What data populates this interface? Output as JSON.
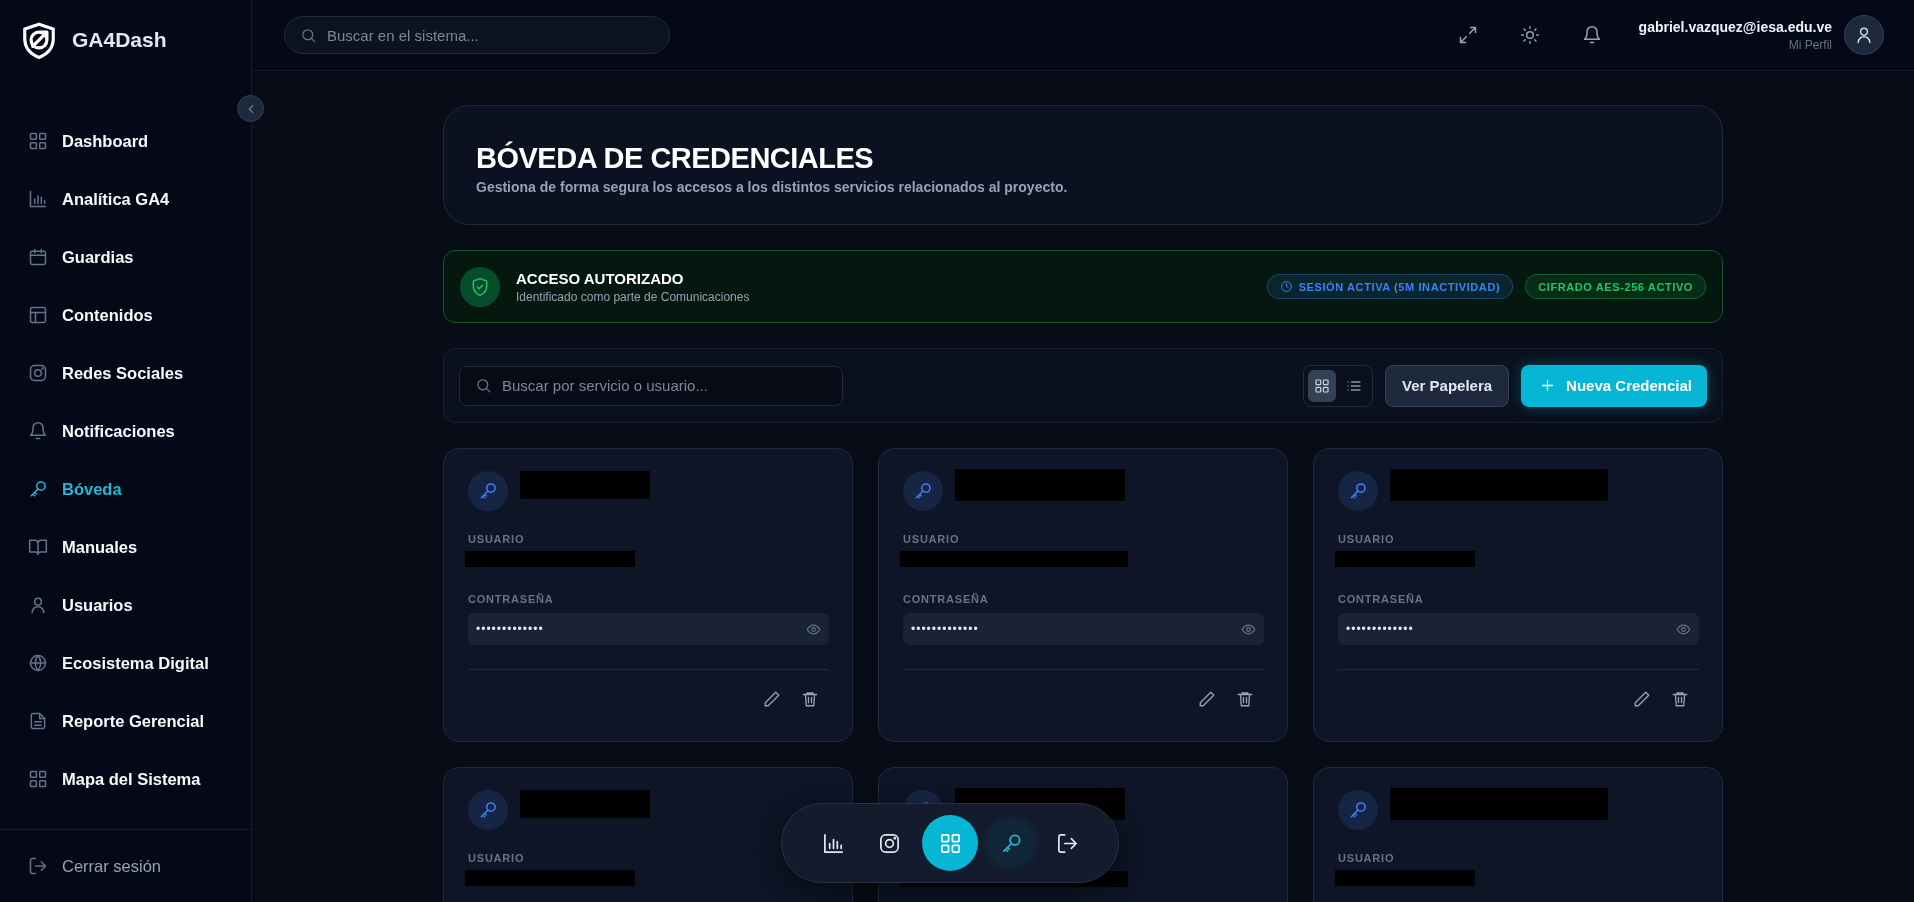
{
  "brand": {
    "name": "GA4Dash"
  },
  "header": {
    "search": {
      "placeholder": "Buscar en el sistema..."
    },
    "user": {
      "email": "gabriel.vazquez@iesa.edu.ve",
      "profile_link": "Mi Perfil"
    }
  },
  "sidebar": {
    "items": [
      {
        "label": "Dashboard",
        "kind": "grid",
        "selected": false
      },
      {
        "label": "Analítica GA4",
        "kind": "chart",
        "selected": false
      },
      {
        "label": "Guardias",
        "kind": "calendar",
        "selected": false
      },
      {
        "label": "Contenidos",
        "kind": "layout",
        "selected": false
      },
      {
        "label": "Redes Sociales",
        "kind": "instagram",
        "selected": false
      },
      {
        "label": "Notificaciones",
        "kind": "bell",
        "selected": false
      },
      {
        "label": "Bóveda",
        "kind": "key",
        "selected": true
      },
      {
        "label": "Manuales",
        "kind": "book",
        "selected": false
      },
      {
        "label": "Usuarios",
        "kind": "user",
        "selected": false
      },
      {
        "label": "Ecosistema Digital",
        "kind": "globe",
        "selected": false
      },
      {
        "label": "Reporte Gerencial",
        "kind": "file",
        "selected": false
      },
      {
        "label": "Mapa del Sistema",
        "kind": "grid",
        "selected": false
      }
    ],
    "logout": "Cerrar sesión"
  },
  "page": {
    "title": "BÓVEDA DE CREDENCIALES",
    "subtitle": "Gestiona de forma segura los accesos a los distintos servicios relacionados al proyecto."
  },
  "access_banner": {
    "title": "ACCESO AUTORIZADO",
    "subtitle": "Identificado como parte de Comunicaciones",
    "badges": [
      {
        "text": "SESIÓN ACTIVA (5M INACTIVIDAD)",
        "color": "#3b82f6"
      },
      {
        "text": "CIFRADO AES-256 ACTIVO",
        "color": "#22c55e"
      }
    ]
  },
  "toolbar": {
    "search": {
      "placeholder": "Buscar por servicio o usuario..."
    },
    "views": [
      {
        "kind": "grid",
        "selected": true
      },
      {
        "kind": "list",
        "selected": false
      }
    ],
    "trash_button": "Ver Papelera",
    "new_button": "Nueva Credencial"
  },
  "credentials": [
    {
      "kind": "full",
      "user_label": "USUARIO",
      "password_label": "CONTRASEÑA",
      "password": "•••••••••••••"
    },
    {
      "kind": "full",
      "user_label": "USUARIO",
      "password_label": "CONTRASEÑA",
      "password": "•••••••••••••"
    },
    {
      "kind": "full",
      "user_label": "USUARIO",
      "password_label": "CONTRASEÑA",
      "password": "•••••••••••••"
    },
    {
      "kind": "partial",
      "user_label": "USUARIO"
    },
    {
      "kind": "partial"
    },
    {
      "kind": "partial",
      "user_label": "USUARIO"
    }
  ],
  "dock": {
    "items": [
      {
        "kind": "chart",
        "selected": false,
        "current": false
      },
      {
        "kind": "instagram",
        "selected": false,
        "current": false
      },
      {
        "kind": "grid",
        "selected": true,
        "current": false
      },
      {
        "kind": "key",
        "selected": false,
        "current": true
      },
      {
        "kind": "logout",
        "selected": false,
        "current": false
      }
    ]
  }
}
